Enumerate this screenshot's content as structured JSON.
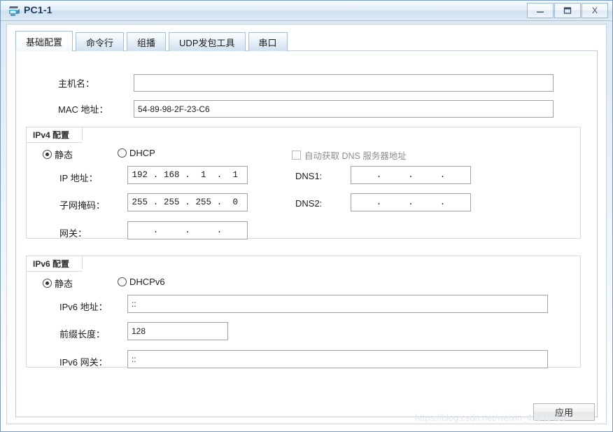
{
  "window": {
    "title": "PC1-1",
    "icon": "pc-device-icon",
    "controls": {
      "minimize": "–",
      "maximize": "❐",
      "close": "X"
    }
  },
  "tabs": [
    {
      "label": "基础配置",
      "active": true
    },
    {
      "label": "命令行",
      "active": false
    },
    {
      "label": "组播",
      "active": false
    },
    {
      "label": "UDP发包工具",
      "active": false
    },
    {
      "label": "串口",
      "active": false
    }
  ],
  "basic": {
    "hostname_label": "主机名：",
    "hostname_value": "",
    "mac_label": "MAC 地址：",
    "mac_value": "54-89-98-2F-23-C6"
  },
  "ipv4": {
    "group_title": "IPv4 配置",
    "mode_static": "静态",
    "mode_dhcp": "DHCP",
    "selected_mode": "静态",
    "auto_dns_label": "自动获取 DNS 服务器地址",
    "auto_dns_checked": false,
    "ip_label": "IP 地址：",
    "ip_octets": [
      "192",
      "168",
      "1",
      "1"
    ],
    "mask_label": "子网掩码：",
    "mask_octets": [
      "255",
      "255",
      "255",
      "0"
    ],
    "gateway_label": "网关：",
    "gateway_octets": [
      "",
      "",
      "",
      ""
    ],
    "dns1_label": "DNS1:",
    "dns1_octets": [
      "",
      "",
      "",
      ""
    ],
    "dns2_label": "DNS2:",
    "dns2_octets": [
      "",
      "",
      "",
      ""
    ]
  },
  "ipv6": {
    "group_title": "IPv6 配置",
    "mode_static": "静态",
    "mode_dhcpv6": "DHCPv6",
    "selected_mode": "静态",
    "addr_label": "IPv6 地址：",
    "addr_value": "::",
    "prefix_label": "前缀长度：",
    "prefix_value": "128",
    "gateway_label": "IPv6 网关：",
    "gateway_value": "::"
  },
  "footer": {
    "apply_label": "应用"
  },
  "watermark": {
    "text": "https://blog.csdn.net/weixin_45849450"
  },
  "colors": {
    "title_accent": "#1a3a5c",
    "window_border": "#7c9cc0",
    "panel_border": "#c3ccd6",
    "field_border": "#a3a3a3"
  }
}
